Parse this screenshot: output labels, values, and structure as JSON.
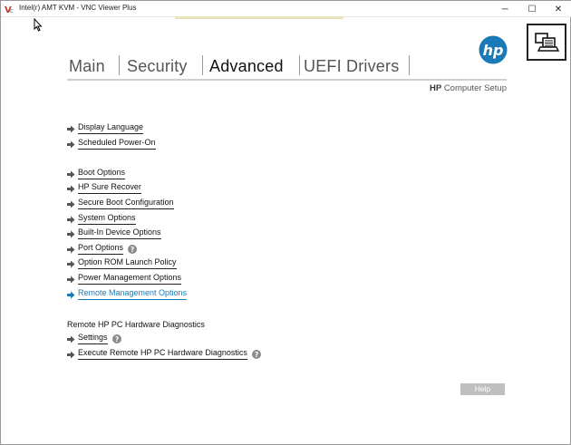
{
  "window": {
    "title": "Intel(r) AMT KVM - VNC Viewer Plus",
    "minimize_glyph": "─",
    "maximize_glyph": "☐",
    "close_glyph": "✕"
  },
  "brand": {
    "logo_text": "hp",
    "subtitle_bold": "HP",
    "subtitle_rest": "Computer Setup",
    "color": "#1a7ab8"
  },
  "tabs": [
    {
      "label": "Main",
      "active": false
    },
    {
      "label": "Security",
      "active": false
    },
    {
      "label": "Advanced",
      "active": true
    },
    {
      "label": "UEFI Drivers",
      "active": false
    }
  ],
  "menu": {
    "group1": [
      {
        "label": "Display Language"
      },
      {
        "label": "Scheduled Power-On"
      }
    ],
    "group2": [
      {
        "label": "Boot Options"
      },
      {
        "label": "HP Sure Recover"
      },
      {
        "label": "Secure Boot Configuration"
      },
      {
        "label": "System Options"
      },
      {
        "label": "Built-In Device Options"
      },
      {
        "label": "Port Options",
        "help": true
      },
      {
        "label": "Option ROM Launch Policy"
      },
      {
        "label": "Power Management Options"
      },
      {
        "label": "Remote Management Options",
        "selected": true
      }
    ],
    "section_label": "Remote HP PC Hardware Diagnostics",
    "group3": [
      {
        "label": "Settings",
        "help": true
      },
      {
        "label": "Execute Remote HP PC Hardware Diagnostics",
        "help": true
      }
    ]
  },
  "help_button": {
    "label": "Help"
  },
  "colors": {
    "accent": "#1a7ab8",
    "help_button_bg": "#bfbfbf",
    "arrow": "#555555"
  }
}
